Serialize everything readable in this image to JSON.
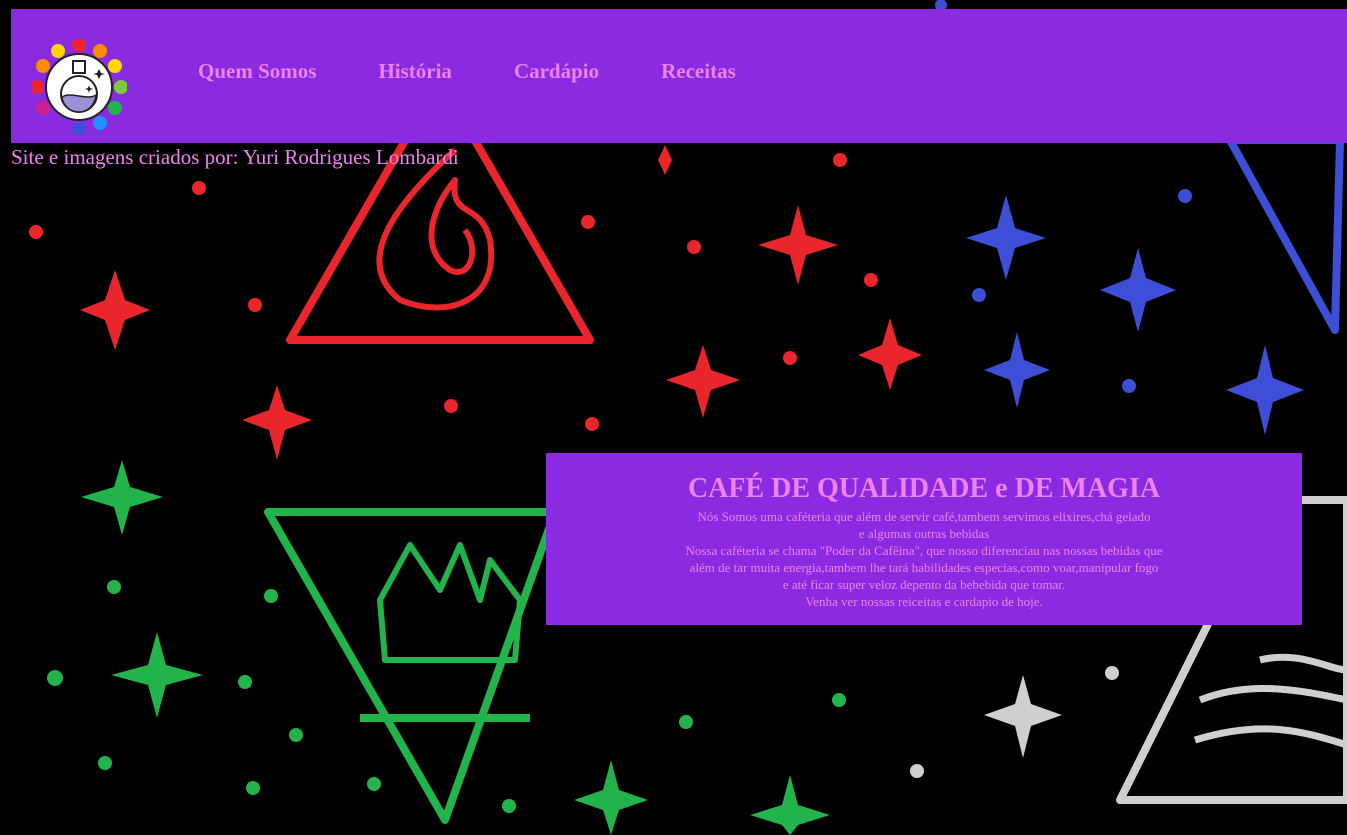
{
  "header": {
    "logo_name": "magic-potion-logo",
    "nav": [
      {
        "label": "Quem Somos"
      },
      {
        "label": "História"
      },
      {
        "label": "Cardápio"
      },
      {
        "label": "Receitas"
      }
    ]
  },
  "credit": "Site e imagens criados por: Yuri Rodrigues Lombardi",
  "main": {
    "title": "CAFÉ DE QUALIDADE e DE MAGIA",
    "lines": [
      "Nós Somos uma caféteria que além de servir café,tambem servimos elixires,chá gelado",
      "e algumas outras bebidas",
      "Nossa caféteria se chama \"Poder da Cafêina\", que nosso diferenciau nas nossas bebidas que",
      "além de tar muita energia,tambem lhe tará habilidades especias,como voar,manipular fogo",
      "e até ficar super veloz depento da bebebida que tomar.",
      "Venha ver nossas reiceitas e cardapio de hoje."
    ]
  },
  "colors": {
    "header_bg": "#8a2be2",
    "text_accent": "#ee82ee",
    "page_bg": "#000000",
    "fire_red": "#e8262b",
    "air_blue": "#3d4fd6",
    "earth_green": "#22b34a",
    "wind_gray": "#cfcfcf"
  }
}
